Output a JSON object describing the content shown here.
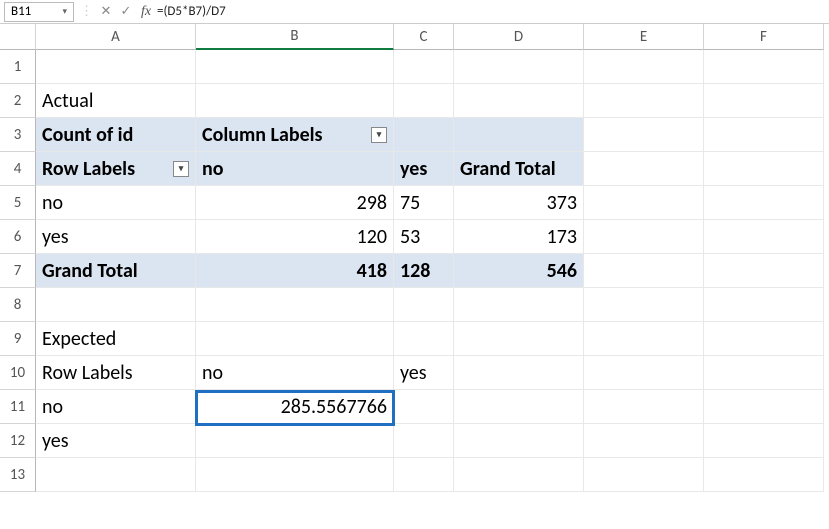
{
  "name_box": "B11",
  "formula": "=(D5*B7)/D7",
  "columns": [
    "A",
    "B",
    "C",
    "D",
    "E",
    "F"
  ],
  "rows": [
    "1",
    "2",
    "3",
    "4",
    "5",
    "6",
    "7",
    "8",
    "9",
    "10",
    "11",
    "12",
    "13"
  ],
  "c": {
    "A2": "Actual",
    "A3": "Count of id",
    "B3": "Column Labels",
    "A4": "Row Labels",
    "B4": "no",
    "C4": "yes",
    "D4": "Grand Total",
    "A5": "no",
    "B5": "298",
    "C5": "75",
    "D5": "373",
    "A6": "yes",
    "B6": "120",
    "C6": "53",
    "D6": "173",
    "A7": "Grand Total",
    "B7": "418",
    "C7": "128",
    "D7": "546",
    "A9": "Expected",
    "A10": "Row Labels",
    "B10": "no",
    "C10": "yes",
    "A11": "no",
    "B11": "285.5567766",
    "A12": "yes"
  },
  "icons": {
    "chev": "▾",
    "x": "✕",
    "check": "✓",
    "dots": "⋮"
  }
}
